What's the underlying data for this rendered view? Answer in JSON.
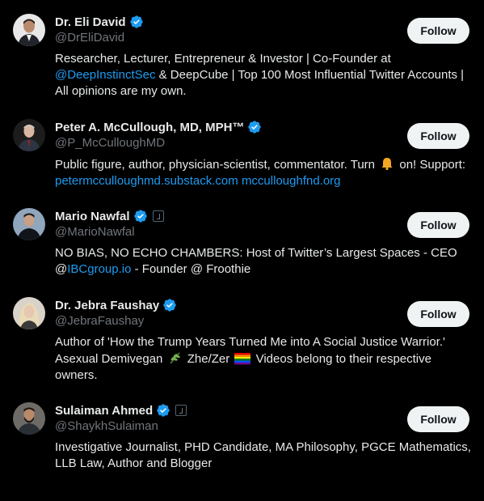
{
  "follow_label": "Follow",
  "accent_color": "#1d9bf0",
  "users": [
    {
      "name": "Dr. Eli David",
      "handle": "@DrEliDavid",
      "bio_parts": [
        "Researcher, Lecturer, Entrepreneur & Investor | Co-Founder at ",
        "@DeepInstinctSec",
        " & DeepCube | Top 100 Most Influential Twitter Accounts | All opinions are my own."
      ]
    },
    {
      "name": "Peter A. McCullough, MD, MPH™",
      "handle": "@P_McCulloughMD",
      "bio_parts": [
        "Public figure, author, physician-scientist, commentator. Turn ",
        " on! Support: ",
        "petermcculloughmd.substack.com",
        " ",
        "mcculloughfnd.org"
      ],
      "bio_icon": "bell-icon"
    },
    {
      "name": "Mario Nawfal",
      "handle": "@MarioNawfal",
      "bio_parts": [
        "NO BIAS, NO ECHO CHAMBERS: Host of Twitter’s Largest Spaces - CEO @",
        "IBCgroup.io",
        " - Founder @ Froothie"
      ]
    },
    {
      "name": "Dr. Jebra Faushay",
      "handle": "@JebraFaushay",
      "bio_parts": [
        "Author of 'How the Trump Years Turned Me into A Social Justice Warrior.' Asexual Demivegan ",
        " Zhe/Zer ",
        " Videos belong to their respective owners."
      ],
      "bio_icons": [
        "herb-icon",
        "rainbow-flag-icon"
      ]
    },
    {
      "name": "Sulaiman Ahmed",
      "handle": "@ShaykhSulaiman",
      "bio_parts": [
        "Investigative Journalist, PHD Candidate, MA Philosophy, PGCE Mathematics, LLB Law, Author and Blogger"
      ]
    }
  ]
}
